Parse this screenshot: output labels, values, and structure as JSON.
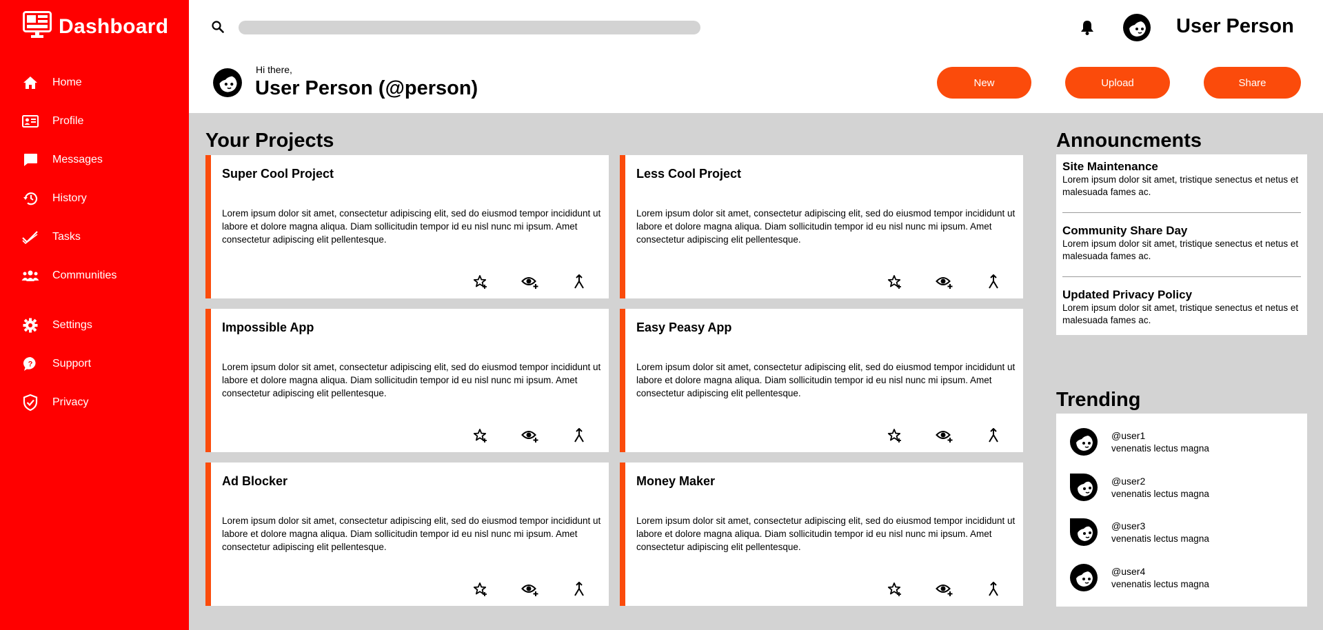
{
  "brand": {
    "title": "Dashboard",
    "icon": "monitor-dashboard-icon"
  },
  "colors": {
    "sidebar": "#ff0000",
    "accent": "#fb4b0b",
    "content_bg": "#d3d3d3"
  },
  "sidebar": {
    "items": [
      {
        "label": "Home",
        "icon": "home-icon"
      },
      {
        "label": "Profile",
        "icon": "id-card-icon"
      },
      {
        "label": "Messages",
        "icon": "chat-bubble-icon"
      },
      {
        "label": "History",
        "icon": "history-icon"
      },
      {
        "label": "Tasks",
        "icon": "checkmark-icon"
      },
      {
        "label": "Communities",
        "icon": "people-icon"
      },
      {
        "label": "Settings",
        "icon": "gear-icon"
      },
      {
        "label": "Support",
        "icon": "help-bubble-icon"
      },
      {
        "label": "Privacy",
        "icon": "shield-icon"
      }
    ]
  },
  "header": {
    "search_placeholder": "",
    "username": "User Person"
  },
  "greeting": {
    "small": "Hi there,",
    "name": "User Person (@person)"
  },
  "actions": {
    "new": "New",
    "upload": "Upload",
    "share": "Share"
  },
  "projects": {
    "title": "Your Projects",
    "items": [
      {
        "title": "Super Cool Project",
        "description": "Lorem ipsum dolor sit amet, consectetur adipiscing elit, sed do eiusmod tempor incididunt ut labore et dolore magna aliqua. Diam sollicitudin tempor id eu nisl nunc mi ipsum. Amet consectetur adipiscing elit pellentesque."
      },
      {
        "title": "Less Cool Project",
        "description": "Lorem ipsum dolor sit amet, consectetur adipiscing elit, sed do eiusmod tempor incididunt ut labore et dolore magna aliqua. Diam sollicitudin tempor id eu nisl nunc mi ipsum. Amet consectetur adipiscing elit pellentesque."
      },
      {
        "title": "Impossible App",
        "description": "Lorem ipsum dolor sit amet, consectetur adipiscing elit, sed do eiusmod tempor incididunt ut labore et dolore magna aliqua. Diam sollicitudin tempor id eu nisl nunc mi ipsum. Amet consectetur adipiscing elit pellentesque."
      },
      {
        "title": "Easy Peasy App",
        "description": "Lorem ipsum dolor sit amet, consectetur adipiscing elit, sed do eiusmod tempor incididunt ut labore et dolore magna aliqua. Diam sollicitudin tempor id eu nisl nunc mi ipsum. Amet consectetur adipiscing elit pellentesque."
      },
      {
        "title": "Ad Blocker",
        "description": "Lorem ipsum dolor sit amet, consectetur adipiscing elit, sed do eiusmod tempor incididunt ut labore et dolore magna aliqua. Diam sollicitudin tempor id eu nisl nunc mi ipsum. Amet consectetur adipiscing elit pellentesque."
      },
      {
        "title": "Money Maker",
        "description": "Lorem ipsum dolor sit amet, consectetur adipiscing elit, sed do eiusmod tempor incididunt ut labore et dolore magna aliqua. Diam sollicitudin tempor id eu nisl nunc mi ipsum. Amet consectetur adipiscing elit pellentesque."
      }
    ]
  },
  "announcements": {
    "title": "Announcments",
    "items": [
      {
        "title": "Site Maintenance",
        "body": "Lorem ipsum dolor sit amet, tristique senectus et netus et malesuada fames ac."
      },
      {
        "title": "Community Share Day",
        "body": "Lorem ipsum dolor sit amet, tristique senectus et netus et malesuada fames ac."
      },
      {
        "title": "Updated Privacy Policy",
        "body": "Lorem ipsum dolor sit amet, tristique senectus et netus et malesuada fames ac."
      }
    ]
  },
  "trending": {
    "title": "Trending",
    "items": [
      {
        "handle": "@user1",
        "subtitle": "venenatis lectus magna"
      },
      {
        "handle": "@user2",
        "subtitle": "venenatis lectus magna"
      },
      {
        "handle": "@user3",
        "subtitle": "venenatis lectus magna"
      },
      {
        "handle": "@user4",
        "subtitle": "venenatis lectus magna"
      }
    ]
  }
}
